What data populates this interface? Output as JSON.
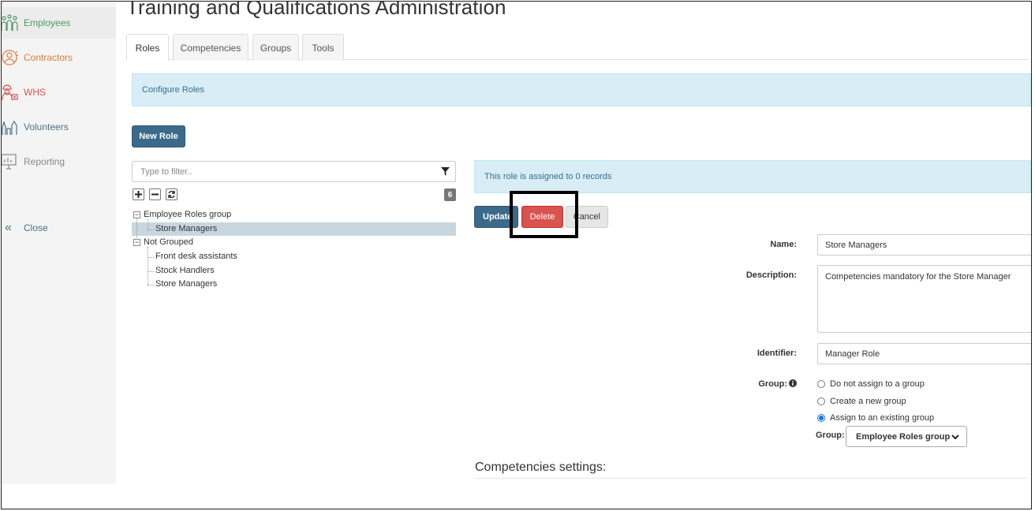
{
  "sidebar": {
    "items": [
      {
        "label": "Employees",
        "icon": "employees-icon",
        "color": "#4a9a5e"
      },
      {
        "label": "Contractors",
        "icon": "contractor-icon",
        "color": "#e07b39"
      },
      {
        "label": "WHS",
        "icon": "whs-icon",
        "color": "#d9534f"
      },
      {
        "label": "Volunteers",
        "icon": "volunteers-icon",
        "color": "#4a6f8a"
      },
      {
        "label": "Reporting",
        "icon": "reporting-icon",
        "color": "#888888"
      }
    ],
    "close_label": "Close"
  },
  "page": {
    "title": "Training and Qualifications Administration"
  },
  "tabs": [
    {
      "label": "Roles",
      "active": true
    },
    {
      "label": "Competencies",
      "active": false
    },
    {
      "label": "Groups",
      "active": false
    },
    {
      "label": "Tools",
      "active": false
    }
  ],
  "configure_banner": "Configure Roles",
  "new_role_button": "New Role",
  "filter": {
    "placeholder": "Type to filter.."
  },
  "tree": {
    "count": "6",
    "groups": [
      {
        "label": "Employee Roles group",
        "children": [
          "Store Managers"
        ]
      },
      {
        "label": "Not Grouped",
        "children": [
          "Front desk assistants",
          "Stock Handlers",
          "Store Managers"
        ]
      }
    ],
    "selected": "Store Managers"
  },
  "assigned_banner": "This role is assigned to 0 records",
  "actions": {
    "update": "Update",
    "delete": "Delete",
    "cancel": "Cancel"
  },
  "form": {
    "name_label": "Name:",
    "name_value": "Store Managers",
    "description_label": "Description:",
    "description_value": "Competencies mandatory for the Store Manager",
    "identifier_label": "Identifier:",
    "identifier_value": "Manager Role",
    "group_label": "Group:",
    "group_options": [
      {
        "label": "Do not assign to a group",
        "checked": false
      },
      {
        "label": "Create a new group",
        "checked": false
      },
      {
        "label": "Assign to an existing group",
        "checked": true
      }
    ],
    "group_select_label": "Group:",
    "group_select_value": "Employee Roles group"
  },
  "competencies_title": "Competencies settings:",
  "colors": {
    "primary": "#3b6a8a",
    "danger": "#d9534f",
    "info_bg": "#d9edf7",
    "info_text": "#31708f"
  }
}
